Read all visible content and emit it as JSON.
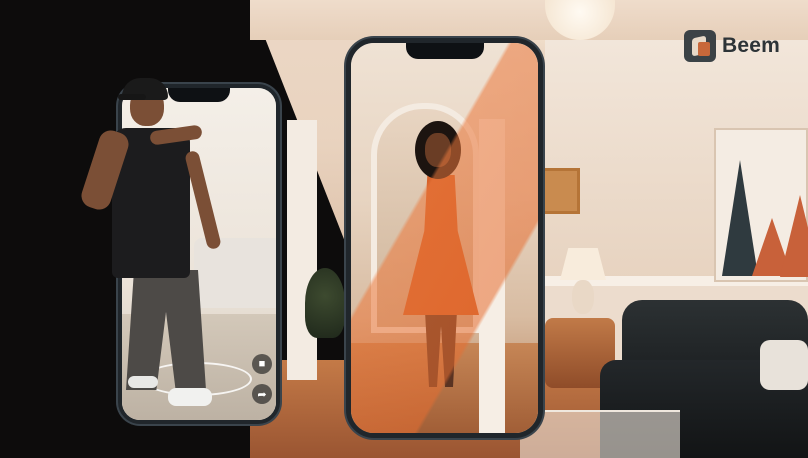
{
  "brand": {
    "name": "Beem",
    "logo_icon": "beem-logo-icon"
  },
  "phones": [
    {
      "subject": "dancer",
      "ui_icons": [
        "chat-bubble-icon",
        "share-icon"
      ]
    },
    {
      "subject": "woman-in-orange-dress",
      "ui_icons": []
    }
  ],
  "colors": {
    "dark_background": "#0d0c0c",
    "accent_orange": "#c8683a",
    "phone_frame": "#20262b"
  }
}
